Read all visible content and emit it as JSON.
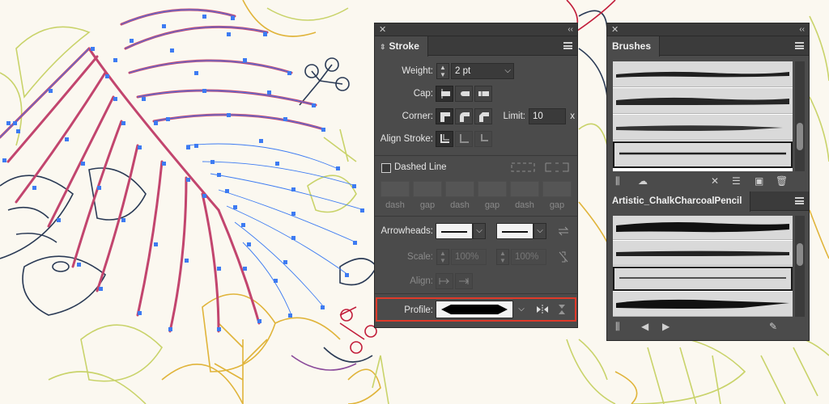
{
  "stroke_panel": {
    "tab_title": "Stroke",
    "weight_label": "Weight:",
    "weight_value": "2 pt",
    "cap_label": "Cap:",
    "corner_label": "Corner:",
    "limit_label": "Limit:",
    "limit_value": "10",
    "limit_unit": "x",
    "align_stroke_label": "Align Stroke:",
    "dashed_line_label": "Dashed Line",
    "dash_labels": [
      "dash",
      "gap",
      "dash",
      "gap",
      "dash",
      "gap"
    ],
    "arrowheads_label": "Arrowheads:",
    "scale_label": "Scale:",
    "scale_value_1": "100%",
    "scale_value_2": "100%",
    "align_label": "Align:",
    "profile_label": "Profile:"
  },
  "brushes_panel": {
    "tab_title": "Brushes"
  },
  "library_panel": {
    "tab_title": "Artistic_ChalkCharcoalPencil"
  },
  "colors": {
    "panel_bg": "#4b4b4b",
    "highlight": "#e03a2a",
    "selection_blue": "#3d7bf2",
    "magenta_path": "#c2456e"
  }
}
